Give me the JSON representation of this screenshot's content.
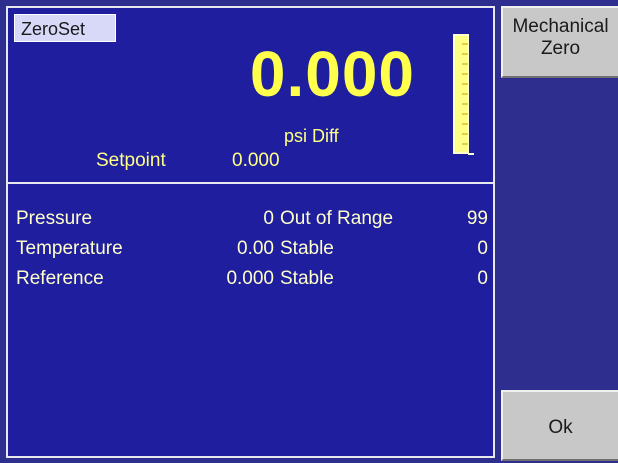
{
  "screen": {
    "title": "ZeroSet",
    "reading": "0.000",
    "units": "psi Diff",
    "setpoint_label": "Setpoint",
    "setpoint_value": "0.000"
  },
  "status_rows": [
    {
      "name": "Pressure",
      "value": "0",
      "status": "Out of Range",
      "count": "99"
    },
    {
      "name": "Temperature",
      "value": "0.00",
      "status": "Stable",
      "count": "0"
    },
    {
      "name": "Reference",
      "value": "0.000",
      "status": "Stable",
      "count": "0"
    }
  ],
  "side_buttons": {
    "mechanical_zero_line1": "Mechanical",
    "mechanical_zero_line2": "Zero",
    "ok": "Ok"
  },
  "colors": {
    "panel_bg": "#1e1e9e",
    "screen_bg": "#2e2e8f",
    "reading": "#ffff4c",
    "button_bg": "#c8c8c8"
  }
}
